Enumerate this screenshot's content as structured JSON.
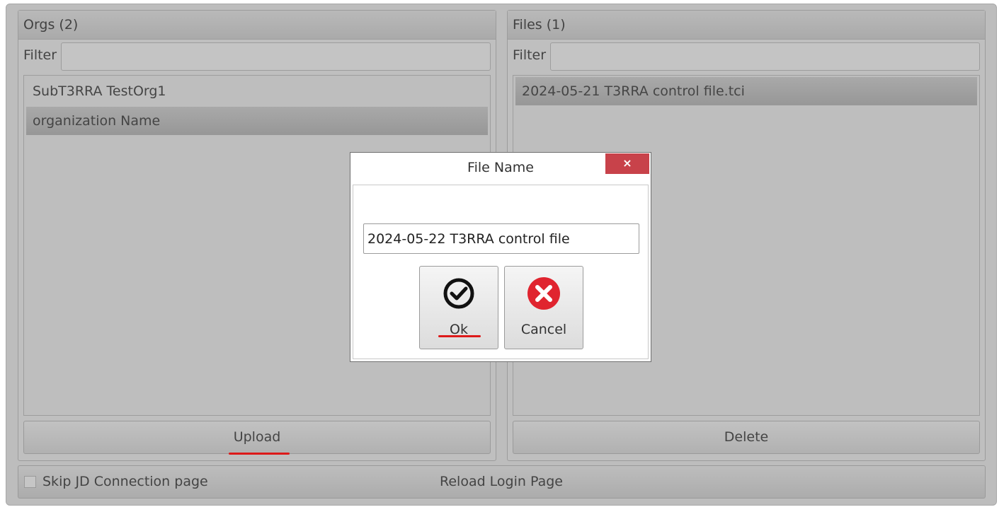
{
  "orgs": {
    "header": "Orgs (2)",
    "filter_label": "Filter",
    "filter_value": "",
    "items": [
      {
        "label": "SubT3RRA TestOrg1"
      },
      {
        "label": "organization Name"
      }
    ],
    "upload_label": "Upload"
  },
  "files": {
    "header": "Files (1)",
    "filter_label": "Filter",
    "filter_value": "",
    "items": [
      {
        "label": "2024-05-21 T3RRA control file.tci"
      }
    ],
    "delete_label": "Delete"
  },
  "footer": {
    "skip_label": "Skip JD Connection page",
    "reload_label": "Reload Login Page"
  },
  "dialog": {
    "title": "File Name",
    "close_glyph": "×",
    "file_name_value": "2024-05-22 T3RRA control file",
    "ok_label": "Ok",
    "cancel_label": "Cancel",
    "ok_icon": "check-circle-icon",
    "cancel_icon": "x-circle-icon"
  },
  "colors": {
    "highlight_red": "#dd1a1a",
    "close_red": "#c8424a",
    "cancel_red": "#e0242f"
  }
}
